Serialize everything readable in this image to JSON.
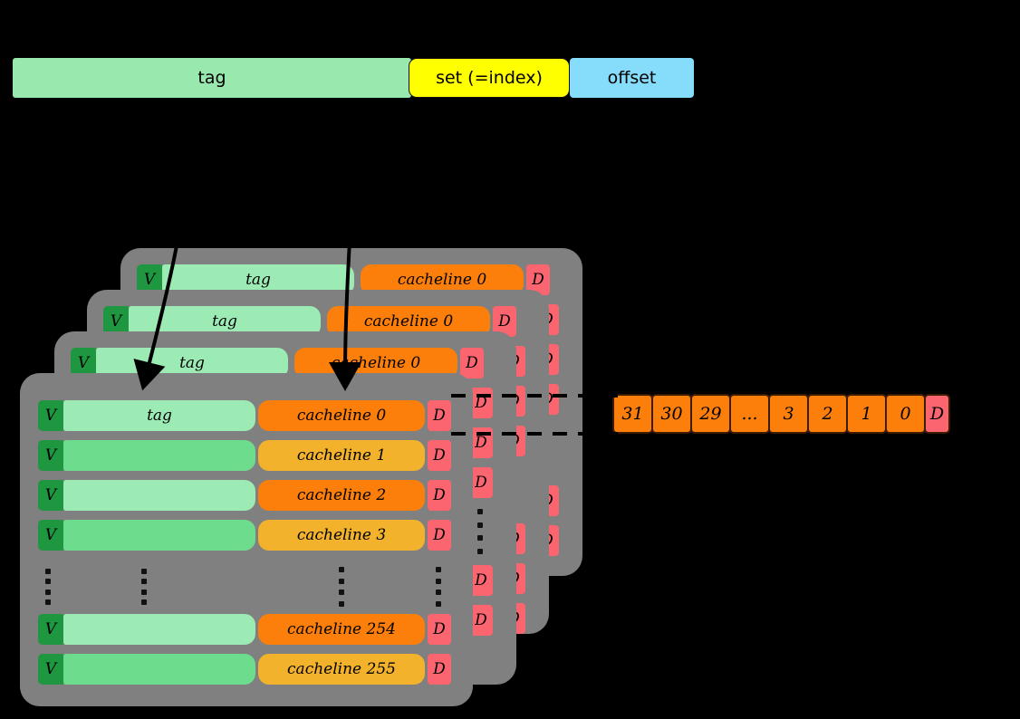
{
  "address_bar": {
    "fields": [
      {
        "label": "tag",
        "color": "#99e8ae",
        "name": "address-field-tag"
      },
      {
        "label": "set (=index)",
        "color": "#ffff00",
        "name": "address-field-set"
      },
      {
        "label": "offset",
        "color": "#86dcfb",
        "name": "address-field-offset"
      }
    ]
  },
  "cache": {
    "ways": 4,
    "panel_color": "#808080",
    "valid_label": "V",
    "dirty_label": "D",
    "tag_label": "tag",
    "front_rows": [
      {
        "valid": "V",
        "tag": "tag",
        "cacheline": "cacheline 0",
        "dirty": "D"
      },
      {
        "valid": "V",
        "tag": "",
        "cacheline": "cacheline 1",
        "dirty": "D"
      },
      {
        "valid": "V",
        "tag": "",
        "cacheline": "cacheline 2",
        "dirty": "D"
      },
      {
        "valid": "V",
        "tag": "",
        "cacheline": "cacheline 3",
        "dirty": "D"
      },
      {
        "valid": "V",
        "tag": "",
        "cacheline": "cacheline 254",
        "dirty": "D"
      },
      {
        "valid": "V",
        "tag": "",
        "cacheline": "cacheline 255",
        "dirty": "D"
      }
    ],
    "back_rows": [
      {
        "valid": "V",
        "tag": "tag",
        "cacheline": "cacheline 0",
        "dirty": "D"
      },
      {
        "valid": "V",
        "tag": "tag",
        "cacheline": "cacheline 0",
        "dirty": "D"
      },
      {
        "valid": "V",
        "tag": "tag",
        "cacheline": "cacheline 0",
        "dirty": "D"
      }
    ],
    "colors": {
      "valid": "#1f9740",
      "tag_light": "#9ceab4",
      "tag_dark": "#6ddc8c",
      "line_orange": "#fd7f0b",
      "line_amber": "#f3b22c",
      "dirty": "#fb6570"
    }
  },
  "byte_array": {
    "cells": [
      "31",
      "30",
      "29",
      "...",
      "3",
      "2",
      "1",
      "0"
    ],
    "dirty": "D"
  }
}
